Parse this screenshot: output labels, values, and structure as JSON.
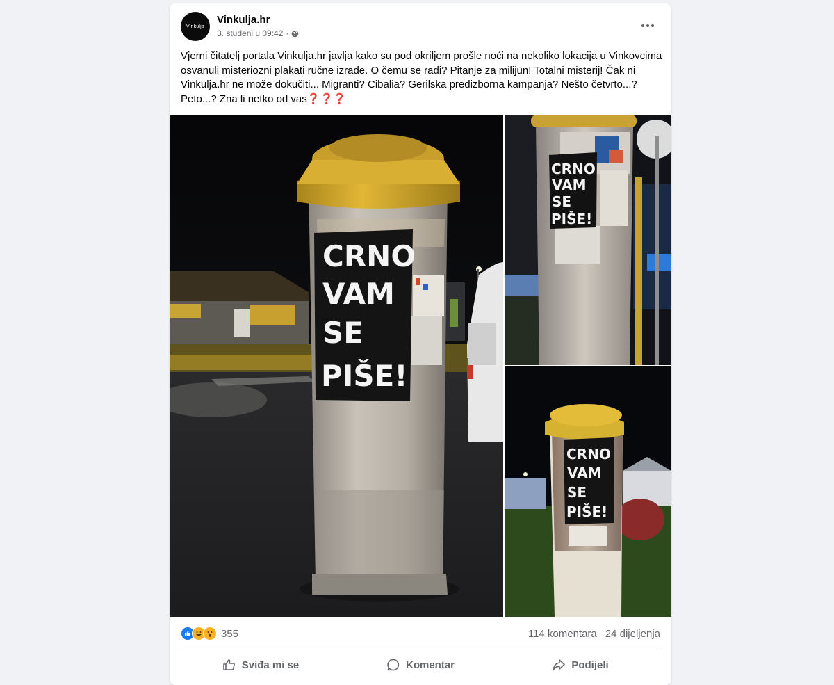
{
  "post": {
    "page_name": "Vinkulja.hr",
    "avatar_text": "Vinkulja",
    "timestamp": "3. studeni u 09:42",
    "caption": "Vjerni čitatelj portala Vinkulja.hr javlja kako su pod okriljem prošle noći na nekoliko lokacija u Vinkovcima osvanuli misteriozni plakati ručne izrade. O čemu se radi? Pitanje za milijun! Totalni misterij! Čak ni Vinkulja.hr ne može dokučiti... Migranti? Cibalia? Gerilska predizborna kampanja? Nešto četvrto...? Peto...? Zna li netko od vas",
    "caption_emoji": "❓❓❓"
  },
  "photos": {
    "poster_lines": [
      "CRNO",
      "VAM",
      "SE",
      "PIŠE!"
    ]
  },
  "stats": {
    "reaction_count": "355",
    "comments": "114 komentara",
    "shares": "24 dijeljenja"
  },
  "actions": {
    "like": "Sviđa mi se",
    "comment": "Komentar",
    "share": "Podijeli"
  },
  "colors": {
    "accent": "#1877f2",
    "background": "#f0f2f5",
    "secondary_text": "#65676b"
  }
}
